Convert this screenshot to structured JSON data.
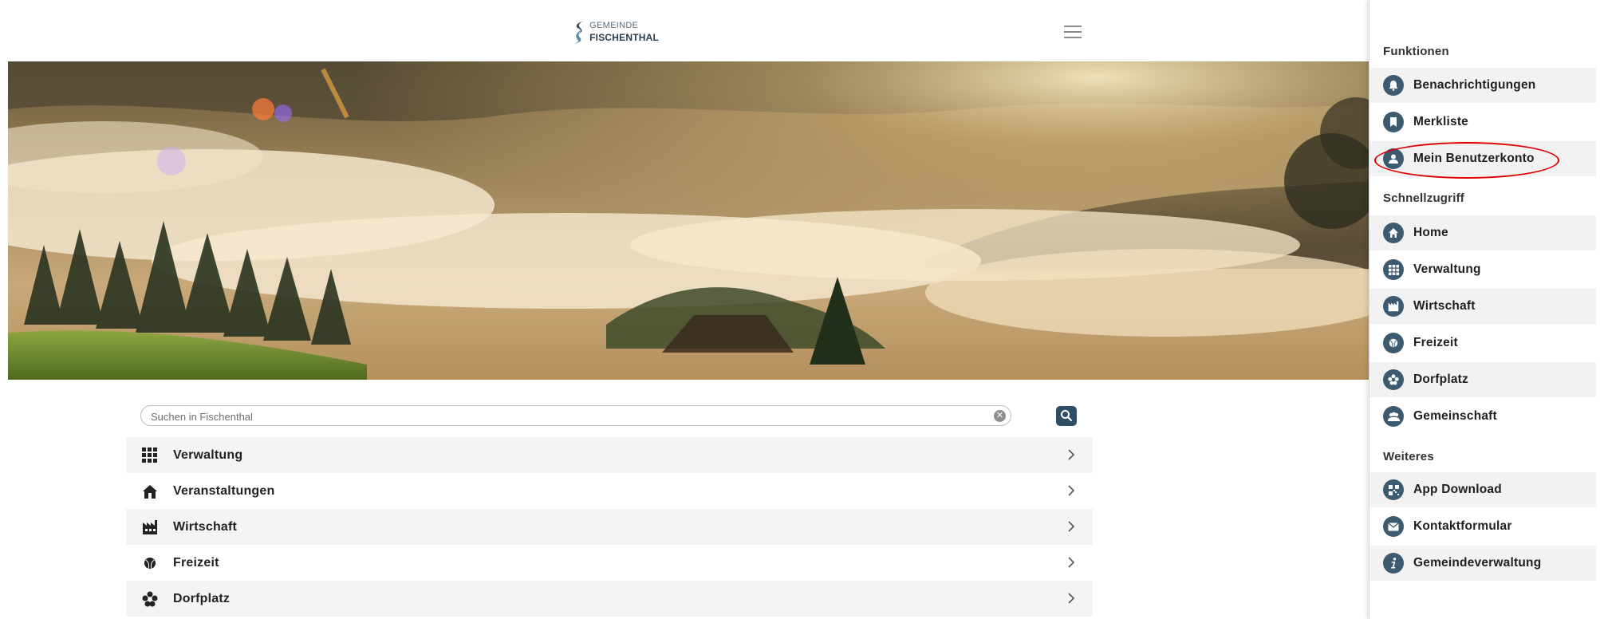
{
  "header": {
    "logo_line1": "GEMEINDE",
    "logo_line2": "FISCHENTHAL",
    "menu_icon": "hamburger-icon"
  },
  "hero": {
    "image": "foggy-landscape"
  },
  "search": {
    "placeholder": "Suchen in Fischenthal",
    "value": "",
    "clear_icon": "clear-icon",
    "button_icon": "search-icon"
  },
  "categories": [
    {
      "label": "Verwaltung",
      "icon": "grid-icon"
    },
    {
      "label": "Veranstaltungen",
      "icon": "tent-icon"
    },
    {
      "label": "Wirtschaft",
      "icon": "factory-icon"
    },
    {
      "label": "Freizeit",
      "icon": "ball-icon"
    },
    {
      "label": "Dorfplatz",
      "icon": "flower-icon"
    }
  ],
  "panel": {
    "functions_heading": "Funktionen",
    "functions": [
      {
        "label": "Benachrichtigungen",
        "icon": "bell-icon"
      },
      {
        "label": "Merkliste",
        "icon": "bookmark-icon"
      },
      {
        "label": "Mein Benutzerkonto",
        "icon": "user-icon"
      }
    ],
    "quick_heading": "Schnellzugriff",
    "quick": [
      {
        "label": "Home",
        "icon": "home-icon"
      },
      {
        "label": "Verwaltung",
        "icon": "grid-icon"
      },
      {
        "label": "Wirtschaft",
        "icon": "factory-icon"
      },
      {
        "label": "Freizeit",
        "icon": "ball-icon"
      },
      {
        "label": "Dorfplatz",
        "icon": "flower-icon"
      },
      {
        "label": "Gemeinschaft",
        "icon": "group-icon"
      }
    ],
    "more_heading": "Weiteres",
    "more": [
      {
        "label": "App Download",
        "icon": "qr-code-icon"
      },
      {
        "label": "Kontaktformular",
        "icon": "mail-icon"
      },
      {
        "label": "Gemeindeverwaltung",
        "icon": "info-icon"
      }
    ]
  },
  "colors": {
    "accent": "#2d4e63",
    "panel_icon_bg": "#3c5a70",
    "highlight": "#e00000",
    "row_shade": "#f4f4f4"
  }
}
